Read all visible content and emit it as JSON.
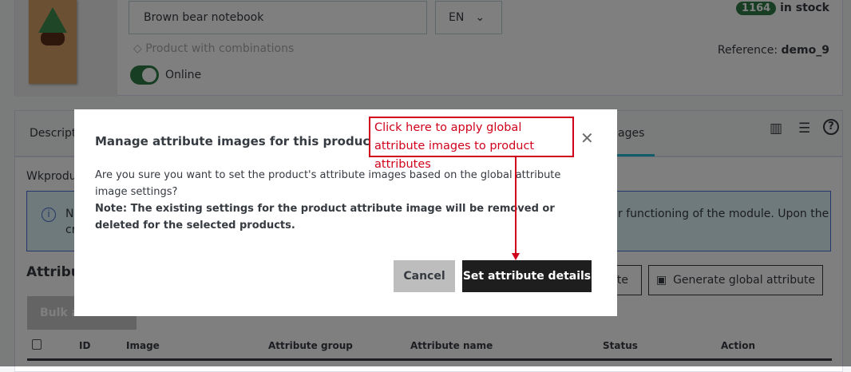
{
  "product": {
    "name": "Brown bear notebook",
    "lang": "EN",
    "combinations": "Product with combinations",
    "online": "Online",
    "stock_count": "1164",
    "stock_label": "in stock",
    "reference_label": "Reference:",
    "reference": "demo_9"
  },
  "tabs": {
    "first": "Descripti",
    "last": "ages"
  },
  "content": {
    "module_title": "Wkproduc",
    "notice_start": "NO",
    "notice_cont": "cr",
    "notice_right": "r functioning of the module. Upon the",
    "section_title": "Attribut",
    "bulk": "Bulk a",
    "btn_partial": "te",
    "generate_btn": "Generate global attribute"
  },
  "table": {
    "headers": [
      "ID",
      "Image",
      "Attribute group",
      "Attribute name",
      "Status",
      "Action"
    ]
  },
  "modal": {
    "title": "Manage attribute images for this product",
    "body": "Are you sure you want to set the product's attribute images based on the global attribute image settings?",
    "note": "Note: The existing settings for the product attribute image will be removed or deleted for the selected products.",
    "cancel": "Cancel",
    "confirm": "Set attribute details"
  },
  "callout": {
    "text": "Click here to apply global attribute images to product attributes",
    "color": "#d0021b"
  }
}
